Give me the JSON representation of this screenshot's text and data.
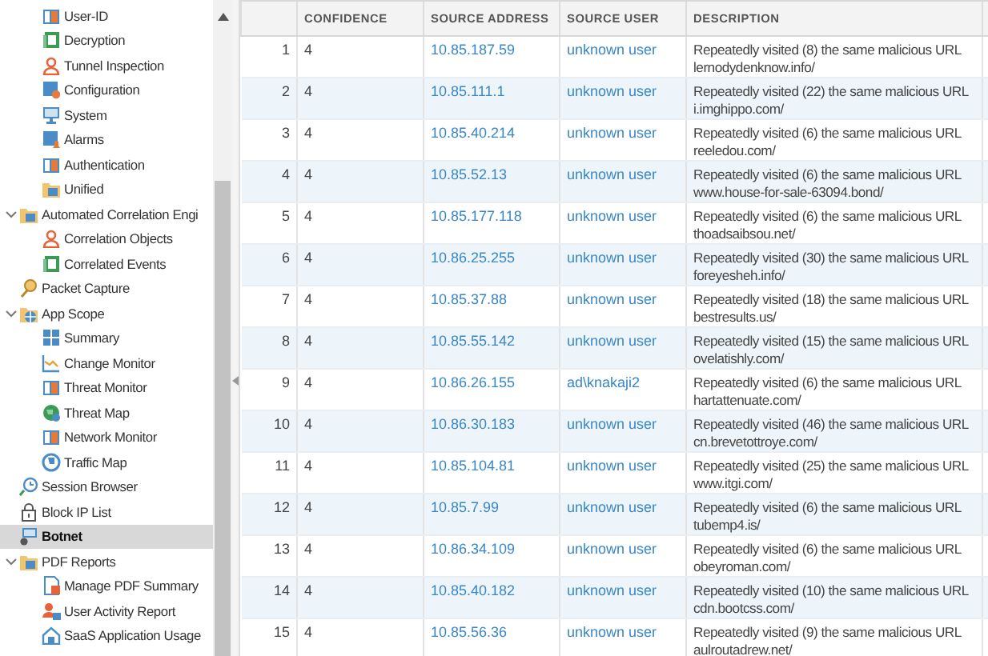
{
  "sidebar": {
    "nested_items": [
      {
        "label": "User-ID",
        "selected": false
      },
      {
        "label": "Decryption",
        "selected": false
      },
      {
        "label": "Tunnel Inspection",
        "selected": false
      },
      {
        "label": "Configuration",
        "selected": false
      },
      {
        "label": "System",
        "selected": false
      },
      {
        "label": "Alarms",
        "selected": false
      },
      {
        "label": "Authentication",
        "selected": false
      },
      {
        "label": "Unified",
        "selected": false
      }
    ],
    "items": [
      {
        "label": "Automated Correlation Engi",
        "selected": false,
        "expanded": true,
        "children": [
          {
            "label": "Correlation Objects",
            "selected": false
          },
          {
            "label": "Correlated Events",
            "selected": false
          }
        ]
      },
      {
        "label": "Packet Capture",
        "selected": false
      },
      {
        "label": "App Scope",
        "selected": false,
        "expanded": true,
        "children": [
          {
            "label": "Summary",
            "selected": false
          },
          {
            "label": "Change Monitor",
            "selected": false
          },
          {
            "label": "Threat Monitor",
            "selected": false
          },
          {
            "label": "Threat Map",
            "selected": false
          },
          {
            "label": "Network Monitor",
            "selected": false
          },
          {
            "label": "Traffic Map",
            "selected": false
          }
        ]
      },
      {
        "label": "Session Browser",
        "selected": false
      },
      {
        "label": "Block IP List",
        "selected": false
      },
      {
        "label": "Botnet",
        "selected": true
      },
      {
        "label": "PDF Reports",
        "selected": false,
        "expanded": true,
        "children": [
          {
            "label": "Manage PDF Summary",
            "selected": false
          },
          {
            "label": "User Activity Report",
            "selected": false
          },
          {
            "label": "SaaS Application Usage",
            "selected": false
          }
        ]
      }
    ]
  },
  "table": {
    "columns": [
      "CONFIDENCE",
      "SOURCE ADDRESS",
      "SOURCE USER",
      "DESCRIPTION"
    ],
    "rows": [
      {
        "index": "1",
        "confidence": "4",
        "source_address": "10.85.187.59",
        "source_user": "unknown user",
        "description": "Repeatedly visited (8) the same malicious URL lernodydenknow.info/"
      },
      {
        "index": "2",
        "confidence": "4",
        "source_address": "10.85.111.1",
        "source_user": "unknown user",
        "description": "Repeatedly visited (22) the same malicious URL i.imghippo.com/"
      },
      {
        "index": "3",
        "confidence": "4",
        "source_address": "10.85.40.214",
        "source_user": "unknown user",
        "description": "Repeatedly visited (6) the same malicious URL reeledou.com/"
      },
      {
        "index": "4",
        "confidence": "4",
        "source_address": "10.85.52.13",
        "source_user": "unknown user",
        "description": "Repeatedly visited (6) the same malicious URL www.house-for-sale-63094.bond/"
      },
      {
        "index": "5",
        "confidence": "4",
        "source_address": "10.85.177.118",
        "source_user": "unknown user",
        "description": "Repeatedly visited (6) the same malicious URL thoadsaibsou.net/"
      },
      {
        "index": "6",
        "confidence": "4",
        "source_address": "10.86.25.255",
        "source_user": "unknown user",
        "description": "Repeatedly visited (30) the same malicious URL foreyesheh.info/"
      },
      {
        "index": "7",
        "confidence": "4",
        "source_address": "10.85.37.88",
        "source_user": "unknown user",
        "description": "Repeatedly visited (18) the same malicious URL bestresults.us/"
      },
      {
        "index": "8",
        "confidence": "4",
        "source_address": "10.85.55.142",
        "source_user": "unknown user",
        "description": "Repeatedly visited (15) the same malicious URL ovelatishly.com/"
      },
      {
        "index": "9",
        "confidence": "4",
        "source_address": "10.86.26.155",
        "source_user": "ad\\knakaji2",
        "description": "Repeatedly visited (6) the same malicious URL hartattenuate.com/"
      },
      {
        "index": "10",
        "confidence": "4",
        "source_address": "10.86.30.183",
        "source_user": "unknown user",
        "description": "Repeatedly visited (46) the same malicious URL cn.brevetottroye.com/"
      },
      {
        "index": "11",
        "confidence": "4",
        "source_address": "10.85.104.81",
        "source_user": "unknown user",
        "description": "Repeatedly visited (25) the same malicious URL www.itgi.com/"
      },
      {
        "index": "12",
        "confidence": "4",
        "source_address": "10.85.7.99",
        "source_user": "unknown user",
        "description": "Repeatedly visited (6) the same malicious URL tubemp4.is/"
      },
      {
        "index": "13",
        "confidence": "4",
        "source_address": "10.86.34.109",
        "source_user": "unknown user",
        "description": "Repeatedly visited (6) the same malicious URL obeyroman.com/"
      },
      {
        "index": "14",
        "confidence": "4",
        "source_address": "10.85.40.182",
        "source_user": "unknown user",
        "description": "Repeatedly visited (10) the same malicious URL cdn.bootcss.com/"
      },
      {
        "index": "15",
        "confidence": "4",
        "source_address": "10.85.56.36",
        "source_user": "unknown user",
        "description": "Repeatedly visited (9) the same malicious URL aulroutadrew.net/"
      }
    ]
  }
}
